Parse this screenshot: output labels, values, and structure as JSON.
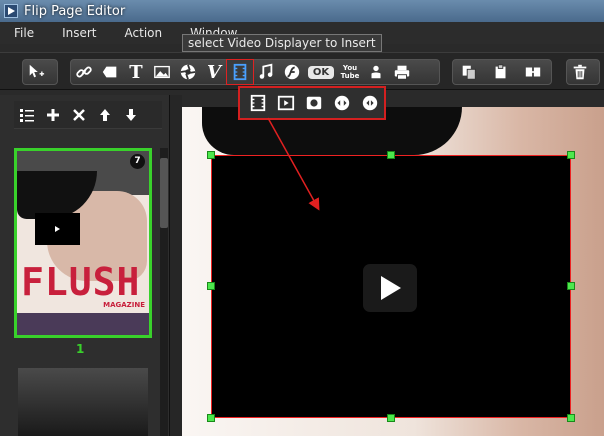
{
  "window": {
    "title": "Flip Page Editor"
  },
  "menu": {
    "items": [
      "File",
      "Insert",
      "Action",
      "Window"
    ]
  },
  "tooltip": {
    "text": "select Video Displayer to Insert"
  },
  "toolbar": {
    "select_tool": "pointer-move-icon",
    "insert_tools": [
      "link-icon",
      "shape-icon",
      "text-icon",
      "image-icon",
      "flash-icon",
      "vimeo-icon",
      "video-icon",
      "music-icon",
      "swf-icon",
      "button-icon",
      "youtube-icon",
      "printer-user-icon",
      "print-icon"
    ],
    "ok_label": "OK",
    "v_label": "V",
    "t_label": "T",
    "yt_label": "You Tube",
    "clipboard_tools": [
      "copy-icon",
      "paste-icon",
      "replace-icon"
    ],
    "delete_tool": "trash-icon"
  },
  "video_popup": {
    "items": [
      "film-icon",
      "video-player-icon",
      "camera-player-icon",
      "eye-player-icon",
      "round-player-icon"
    ]
  },
  "pages_panel": {
    "toolbar": [
      "list-icon",
      "add-icon",
      "remove-icon",
      "move-up-icon",
      "move-down-icon"
    ],
    "thumbnails": [
      {
        "page_number": "1",
        "badge": "7",
        "cover_title": "FLUSH",
        "cover_subtitle": "MAGAZINE",
        "selected": true
      },
      {
        "page_number": "",
        "selected": false
      }
    ]
  },
  "canvas": {
    "video_placeholder": "play-icon"
  },
  "colors": {
    "selection_border": "#d42020",
    "handle": "#4de84d",
    "thumbnail_selected": "#39d12b",
    "cover_title": "#c8203c"
  }
}
